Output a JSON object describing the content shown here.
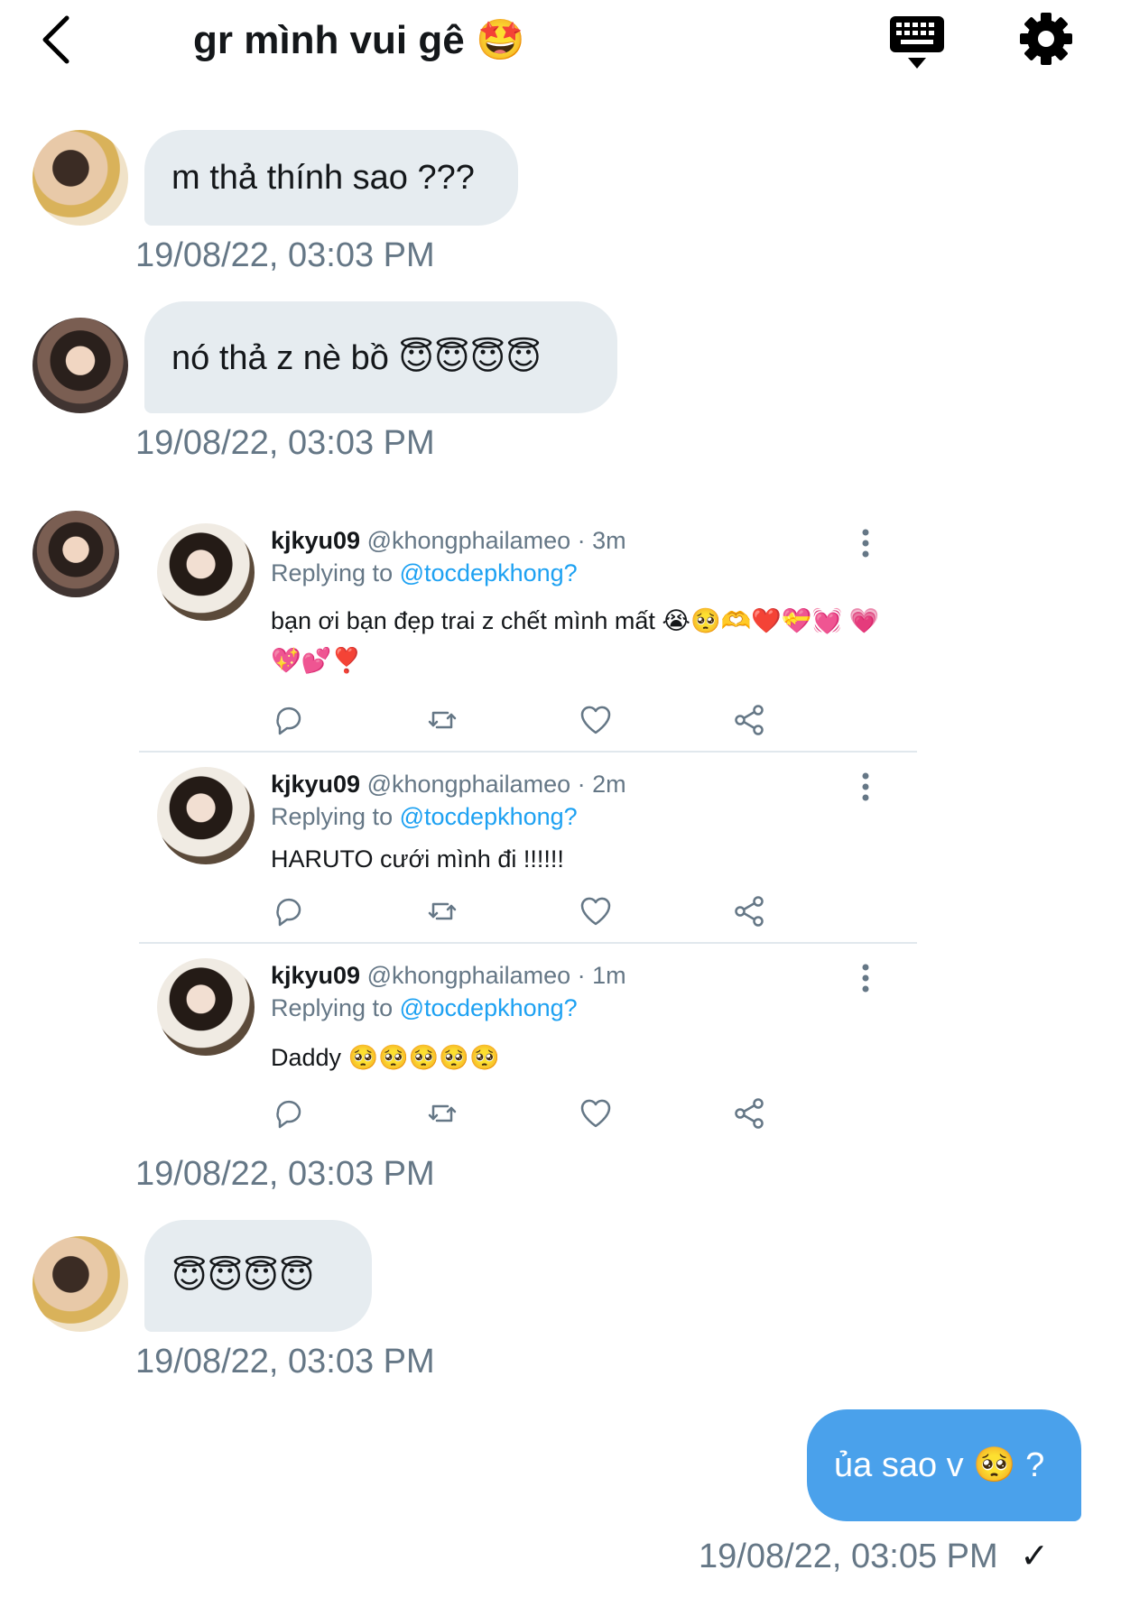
{
  "header": {
    "title": "gr mình vui gê",
    "title_emoji": "🤩",
    "back_icon": "chevron-left-icon",
    "keyboard_icon": "keyboard-icon",
    "settings_icon": "gear-icon"
  },
  "messages": [
    {
      "text": "m thả thính sao ???",
      "time": "19/08/22, 03:03 PM"
    },
    {
      "text": "nó thả z nè bồ 😇😇😇😇",
      "time": "19/08/22, 03:03 PM"
    },
    {
      "time": "19/08/22, 03:03 PM"
    },
    {
      "text": "😇😇😇😇",
      "time": "19/08/22, 03:03 PM"
    },
    {
      "text": "ủa sao v 🥺 ?",
      "time": "19/08/22, 03:05 PM",
      "status": "✓"
    }
  ],
  "tweets": [
    {
      "name": "kjkyu09",
      "handle": "@khongphailameo",
      "age": "· 3m",
      "replying_prefix": "Replying to",
      "replying_to": "@tocdepkhong?",
      "body": "bạn ơi bạn đẹp trai z chết mình mất 😭🥺🫶❤️💝💓 💗💖💕❣️"
    },
    {
      "name": "kjkyu09",
      "handle": "@khongphailameo",
      "age": "· 2m",
      "replying_prefix": "Replying to",
      "replying_to": "@tocdepkhong?",
      "body": "HARUTO cưới mình đi !!!!!!"
    },
    {
      "name": "kjkyu09",
      "handle": "@khongphailameo",
      "age": "· 1m",
      "replying_prefix": "Replying to",
      "replying_to": "@tocdepkhong?",
      "body": "Daddy 🥺🥺🥺🥺🥺"
    }
  ],
  "colors": {
    "bubble_incoming": "#e6ecf0",
    "bubble_outgoing": "#4aa1eb",
    "timestamp": "#657786",
    "mention": "#1da1f2"
  }
}
